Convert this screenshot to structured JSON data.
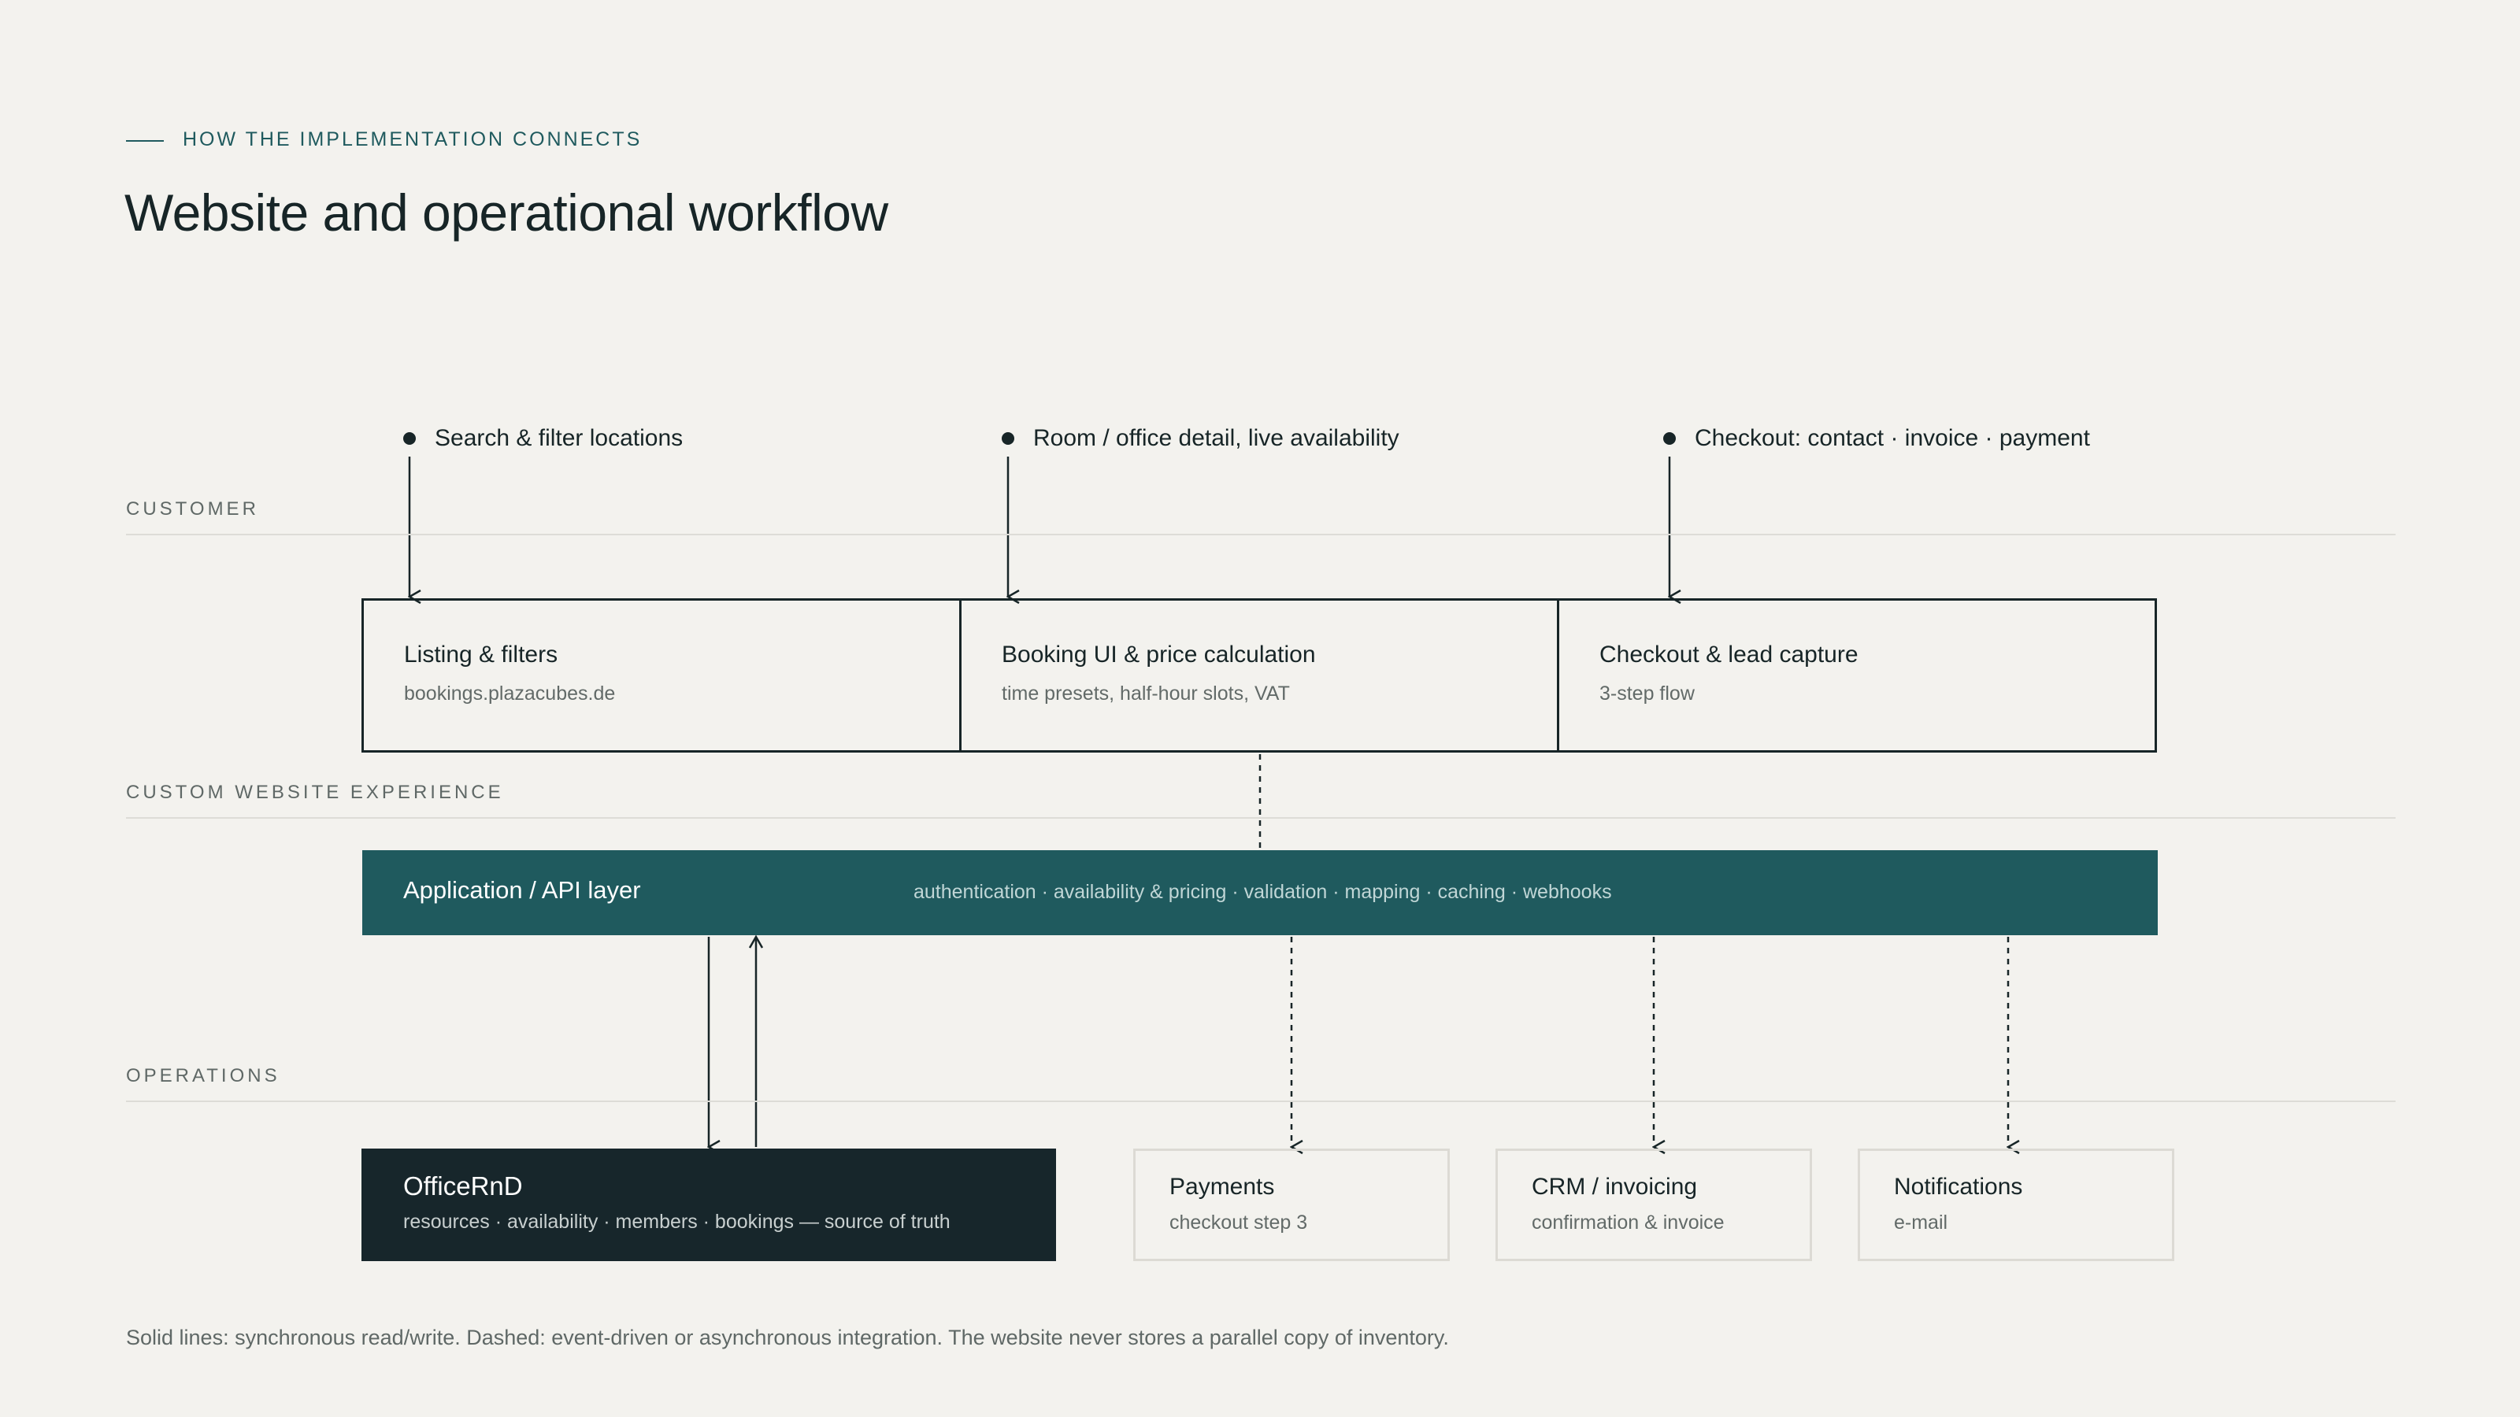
{
  "header": {
    "eyebrow": "HOW THE IMPLEMENTATION CONNECTS",
    "title": "Website and operational workflow"
  },
  "lanes": {
    "customer": "CUSTOMER",
    "website": "CUSTOM WEBSITE EXPERIENCE",
    "operations": "OPERATIONS"
  },
  "customer_steps": [
    {
      "label": "Search & filter locations"
    },
    {
      "label": "Room / office detail, live availability"
    },
    {
      "label": "Checkout: contact · invoice · payment"
    }
  ],
  "website_blocks": [
    {
      "title": "Listing & filters",
      "subtitle": "bookings.plazacubes.de"
    },
    {
      "title": "Booking UI & price calculation",
      "subtitle": "time presets, half-hour slots, VAT"
    },
    {
      "title": "Checkout & lead capture",
      "subtitle": "3-step flow"
    }
  ],
  "api_layer": {
    "title": "Application / API layer",
    "subtitle": "authentication · availability & pricing · validation · mapping · caching · webhooks"
  },
  "operations": {
    "source_of_truth": {
      "title": "OfficeRnD",
      "subtitle": "resources · availability · members · bookings — source of truth"
    },
    "integrations": [
      {
        "title": "Payments",
        "subtitle": "checkout step 3"
      },
      {
        "title": "CRM / invoicing",
        "subtitle": "confirmation & invoice"
      },
      {
        "title": "Notifications",
        "subtitle": "e-mail"
      }
    ]
  },
  "caption": "Solid lines: synchronous read/write. Dashed: event-driven or asynchronous integration. The website never stores a parallel copy of inventory.",
  "colors": {
    "background": "#f3f2ee",
    "ink": "#172527",
    "accent_teal": "#1f5a5e",
    "officernd_dark": "#17262b",
    "muted_text": "#626a68",
    "rule": "#dddcd7"
  }
}
